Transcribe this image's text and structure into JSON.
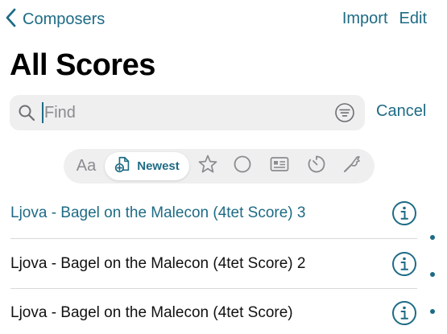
{
  "nav": {
    "back_label": "Composers",
    "import_label": "Import",
    "edit_label": "Edit"
  },
  "page": {
    "title": "All Scores"
  },
  "search": {
    "placeholder": "Find",
    "value": "",
    "cancel_label": "Cancel"
  },
  "sort_bar": {
    "items": [
      {
        "name": "Aa",
        "label": "Aa",
        "selected": false
      },
      {
        "name": "newest",
        "label": "Newest",
        "selected": true,
        "icon": "new-document-icon"
      },
      {
        "name": "star",
        "icon": "star-icon",
        "selected": false
      },
      {
        "name": "circle",
        "icon": "circle-icon",
        "selected": false
      },
      {
        "name": "card",
        "icon": "id-card-icon",
        "selected": false
      },
      {
        "name": "timer",
        "icon": "timer-icon",
        "selected": false
      },
      {
        "name": "tools",
        "icon": "tools-icon",
        "selected": false
      }
    ]
  },
  "scores": [
    {
      "title": "Ljova - Bagel on the Malecon (4tet Score) 3",
      "active": true
    },
    {
      "title": "Ljova - Bagel on the Malecon (4tet Score) 2",
      "active": false
    },
    {
      "title": "Ljova - Bagel on the Malecon (4tet Score)",
      "active": false
    }
  ],
  "colors": {
    "accent": "#1e6b85",
    "field_bg": "#efeff0",
    "divider": "#d9d9dc"
  }
}
